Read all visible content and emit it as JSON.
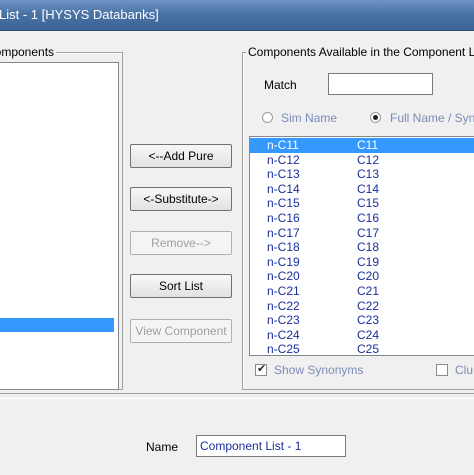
{
  "window": {
    "title": "List - 1 [HYSYS Databanks]"
  },
  "selected_group": {
    "label": "Components"
  },
  "available_group": {
    "label": "Components Available in the Component L",
    "match_label": "Match",
    "match_value": "",
    "radio_sim_name": "Sim Name",
    "radio_full_name": "Full Name / Syn",
    "radio_selected": "Full Name / Syn",
    "components": [
      {
        "sim": "n-C11",
        "full": "C11",
        "selected": true
      },
      {
        "sim": "n-C12",
        "full": "C12"
      },
      {
        "sim": "n-C13",
        "full": "C13"
      },
      {
        "sim": "n-C14",
        "full": "C14"
      },
      {
        "sim": "n-C15",
        "full": "C15"
      },
      {
        "sim": "n-C16",
        "full": "C16"
      },
      {
        "sim": "n-C17",
        "full": "C17"
      },
      {
        "sim": "n-C18",
        "full": "C18"
      },
      {
        "sim": "n-C19",
        "full": "C19"
      },
      {
        "sim": "n-C20",
        "full": "C20"
      },
      {
        "sim": "n-C21",
        "full": "C21"
      },
      {
        "sim": "n-C22",
        "full": "C22"
      },
      {
        "sim": "n-C23",
        "full": "C23"
      },
      {
        "sim": "n-C24",
        "full": "C24"
      },
      {
        "sim": "n-C25",
        "full": "C25"
      }
    ],
    "show_synonyms_label": "Show Synonyms",
    "show_synonyms_checked": true,
    "cluster_label": "Clu",
    "cluster_checked": false
  },
  "buttons": {
    "add_pure": "<--Add Pure",
    "substitute": "<-Substitute->",
    "remove": "Remove-->",
    "sort_list": "Sort List",
    "view_component": "View Component"
  },
  "footer": {
    "name_label": "Name",
    "name_value": "Component List - 1"
  },
  "colors": {
    "title_bar": "#4a73a6",
    "selection": "#3399ff",
    "list_text": "#1b2f9b"
  }
}
